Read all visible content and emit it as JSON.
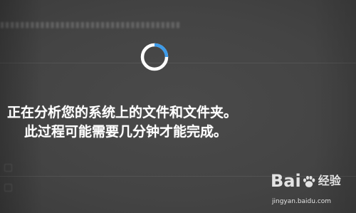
{
  "setup": {
    "status_line_1": "正在分析您的系统上的文件和文件夹。",
    "status_line_2": "此过程可能需要几分钟才能完成。",
    "spinner_progress": 0.25,
    "spinner_track_color": "#ffffff",
    "spinner_arc_color": "#3d9be9"
  },
  "watermark": {
    "logo_left": "Bai",
    "logo_right": "经验",
    "url": "jingyan.baidu.com"
  },
  "colors": {
    "background": "#464646",
    "text": "#ffffff"
  }
}
